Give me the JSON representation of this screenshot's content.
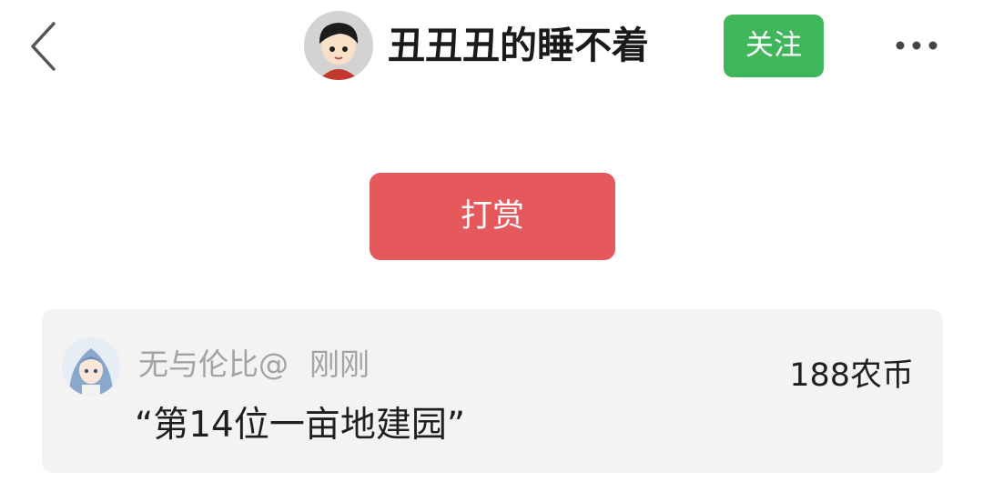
{
  "header": {
    "author_name": "丑丑丑的睡不着",
    "follow_label": "关注",
    "icons": {
      "back": "back-chevron-icon",
      "more": "more-dots-icon"
    }
  },
  "tip": {
    "button_label": "打赏"
  },
  "tip_record": {
    "user_name": "无与伦比@",
    "time": "刚刚",
    "amount": "188农币",
    "message": "“第14位一亩地建园”"
  },
  "colors": {
    "follow_button": "#40b65b",
    "tip_button": "#e5585c",
    "card_background": "#f3f3f3",
    "muted_text": "#a3a3a3"
  }
}
